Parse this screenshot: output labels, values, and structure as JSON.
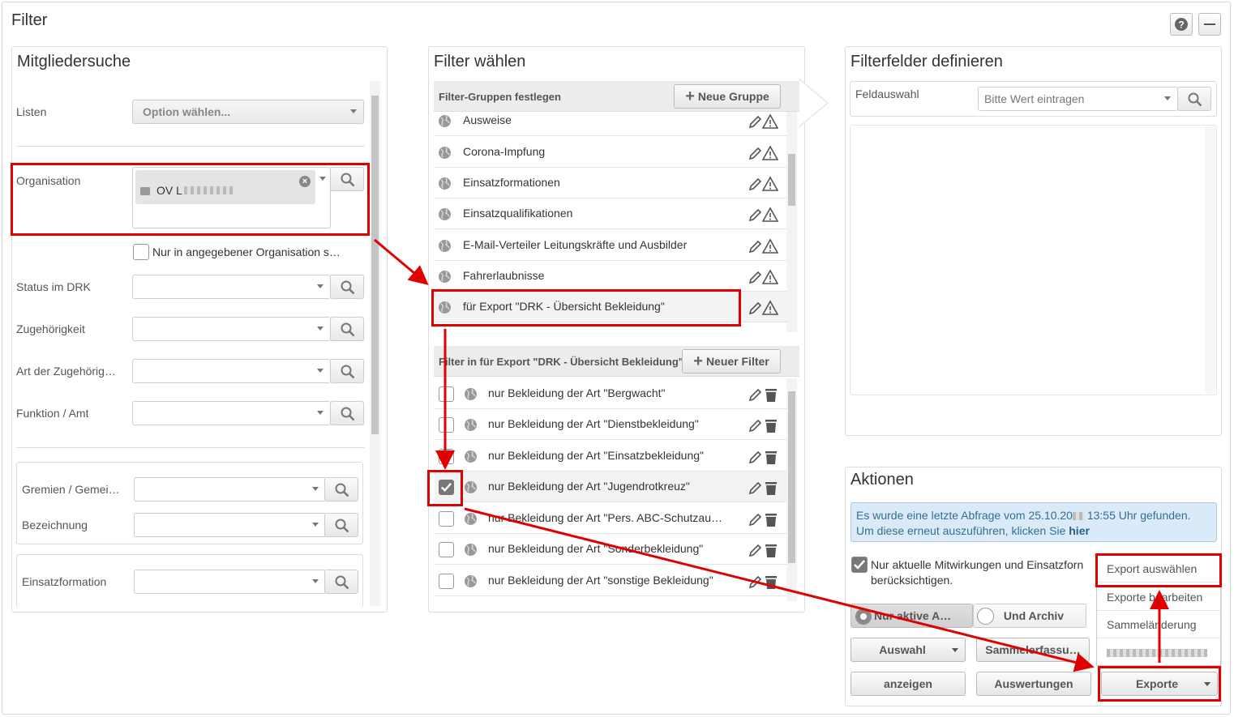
{
  "window": {
    "title": "Filter"
  },
  "left": {
    "title": "Mitgliedersuche",
    "listen_label": "Listen",
    "listen_placeholder": "Option wählen...",
    "org_label": "Organisation",
    "org_tag": "OV L",
    "nur_org_label": "Nur in angegebener Organisation s…",
    "status_label": "Status im DRK",
    "zugehoerigkeit_label": "Zugehörigkeit",
    "art_label": "Art der Zugehörig…",
    "funktion_label": "Funktion / Amt",
    "gremien_label": "Gremien / Gemei…",
    "bezeichnung_label": "Bezeichnung",
    "einsatzformation_label": "Einsatzformation"
  },
  "middle": {
    "title": "Filter wählen",
    "groups_header": "Filter-Gruppen festlegen",
    "new_group": "Neue Gruppe",
    "groups": [
      "Ausweise",
      "Corona-Impfung",
      "Einsatzformationen",
      "Einsatzqualifikationen",
      "E-Mail-Verteiler Leitungskräfte und Ausbilder",
      "Fahrerlaubnisse",
      "für Export \"DRK - Übersicht Bekleidung\""
    ],
    "filters_header": "Filter in für Export \"DRK - Übersicht Bekleidung\"",
    "new_filter": "Neuer Filter",
    "filters": [
      {
        "label": "nur Bekleidung der Art \"Bergwacht\"",
        "checked": false
      },
      {
        "label": "nur Bekleidung der Art \"Dienstbekleidung\"",
        "checked": false
      },
      {
        "label": "nur Bekleidung der Art \"Einsatzbekleidung\"",
        "checked": false
      },
      {
        "label": "nur Bekleidung der Art \"Jugendrotkreuz\"",
        "checked": true
      },
      {
        "label": "nur Bekleidung der Art \"Pers. ABC-Schutzau…",
        "checked": false
      },
      {
        "label": "nur Bekleidung der Art \"Sonderbekleidung\"",
        "checked": false
      },
      {
        "label": "nur Bekleidung der Art \"sonstige Bekleidung\"",
        "checked": false
      }
    ]
  },
  "right": {
    "title": "Filterfelder definieren",
    "feld_label": "Feldauswahl",
    "feld_placeholder": "Bitte Wert eintragen"
  },
  "actions": {
    "title": "Aktionen",
    "info_text": "Es wurde eine letzte Abfrage vom 25.10.20",
    "info_text2": " 13:55 Uhr gefunden. Um diese erneut auszuführen, klicken Sie ",
    "info_link": "hier",
    "check_label_1": "Nur aktuelle Mitwirkungen und Einsatzforn",
    "check_label_2": "berücksichtigen.",
    "radio_active": "Nur aktive A…",
    "radio_archive": "Und Archiv",
    "auswahl": "Auswahl",
    "sammelerfassung": "Sammelerfassu…",
    "anzeigen": "anzeigen",
    "auswertungen": "Auswertungen",
    "exporte": "Exporte",
    "menu": [
      "Export auswählen",
      "Exporte bearbeiten",
      "Sammeländerung"
    ]
  },
  "colors": {
    "highlight": "#e00000",
    "info_bg": "#dbeaf8"
  }
}
